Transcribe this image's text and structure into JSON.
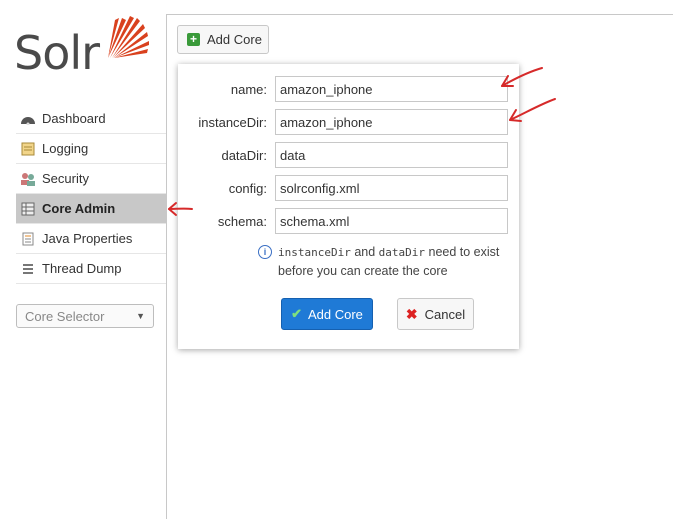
{
  "logo": {
    "text": "Solr"
  },
  "nav": {
    "items": [
      {
        "label": "Dashboard",
        "icon": "dashboard-icon",
        "active": false
      },
      {
        "label": "Logging",
        "icon": "logging-icon",
        "active": false
      },
      {
        "label": "Security",
        "icon": "security-icon",
        "active": false
      },
      {
        "label": "Core Admin",
        "icon": "core-admin-icon",
        "active": true
      },
      {
        "label": "Java Properties",
        "icon": "java-properties-icon",
        "active": false
      },
      {
        "label": "Thread Dump",
        "icon": "thread-dump-icon",
        "active": false
      }
    ]
  },
  "core_selector": {
    "label": "Core Selector"
  },
  "toolbar": {
    "add_core_label": "Add Core"
  },
  "dialog": {
    "fields": [
      {
        "label": "name:",
        "value": "amazon_iphone"
      },
      {
        "label": "instanceDir:",
        "value": "amazon_iphone"
      },
      {
        "label": "dataDir:",
        "value": "data"
      },
      {
        "label": "config:",
        "value": "solrconfig.xml"
      },
      {
        "label": "schema:",
        "value": "schema.xml"
      }
    ],
    "note": {
      "code1": "instanceDir",
      "and": " and ",
      "code2": "dataDir",
      "rest": " need to exist before you can create the core"
    },
    "submit_label": "Add Core",
    "cancel_label": "Cancel"
  },
  "colors": {
    "accent": "#1f7ad6",
    "annotation": "#d62a2a",
    "active_nav": "#c8c8c8"
  }
}
